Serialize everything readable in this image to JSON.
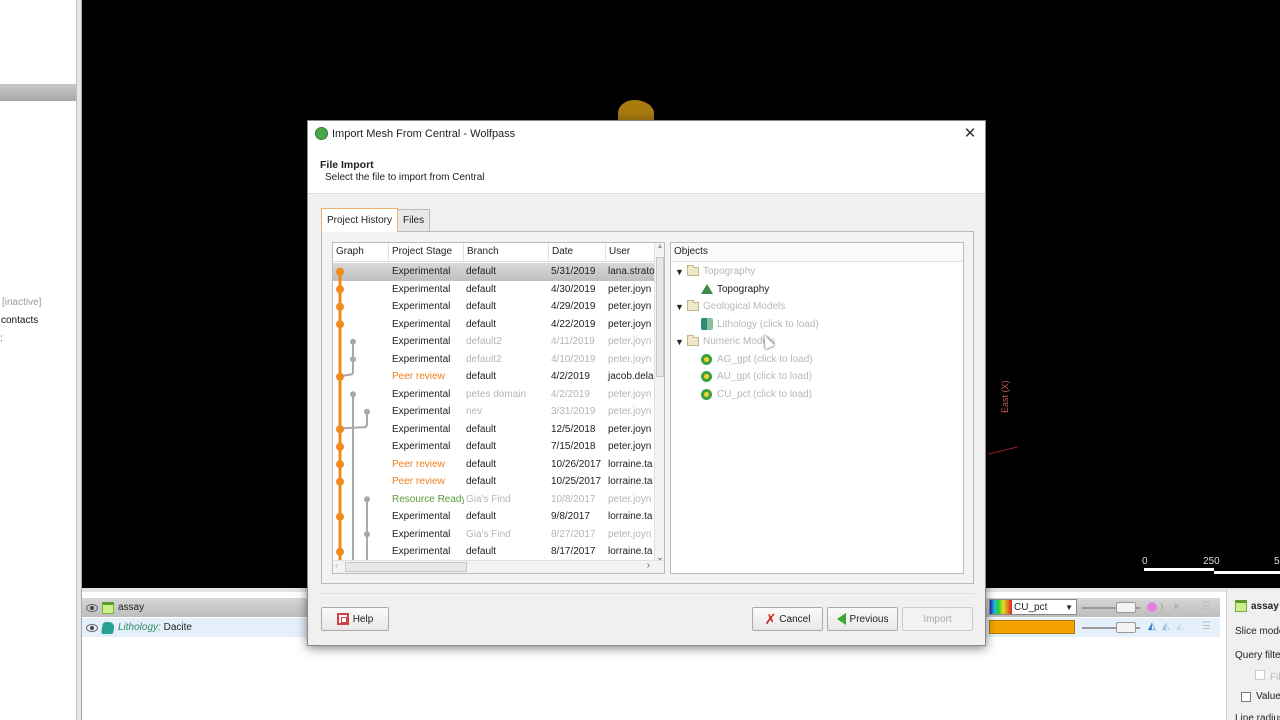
{
  "left_panel": {
    "inactive_label": "[inactive]",
    "contacts_label": "contacts",
    "tick": ":"
  },
  "viewport": {
    "axis_label": "East (X)",
    "scale_labels": [
      "0",
      "250",
      "5"
    ]
  },
  "scene_list": {
    "rows": [
      {
        "name": "assay",
        "prefix": "",
        "colormap": "CU_pct"
      },
      {
        "name": "Dacite",
        "prefix": "Lithology:",
        "swatch_color": "#f5a300"
      }
    ]
  },
  "properties": {
    "title": "assay",
    "slice_mode": "Slice mode",
    "query_filter": "Query filter",
    "filter": "Filter",
    "value_filter": "Value filter",
    "line_radius": "Line radius"
  },
  "dialog": {
    "title": "Import Mesh From Central - Wolfpass",
    "close": "✕",
    "header_title": "File Import",
    "header_subtitle": "Select the file to import from Central",
    "tabs": [
      {
        "label": "Project History",
        "active": true
      },
      {
        "label": "Files",
        "active": false
      }
    ],
    "history": {
      "columns": [
        "Graph",
        "Project Stage",
        "Branch",
        "Date",
        "User"
      ],
      "rows": [
        {
          "stage": "Experimental",
          "branch": "default",
          "date": "5/31/2019",
          "user": "lana.strato",
          "muted": false,
          "stage_style": "normal",
          "selected": true
        },
        {
          "stage": "Experimental",
          "branch": "default",
          "date": "4/30/2019",
          "user": "peter.joyn",
          "muted": false,
          "stage_style": "normal"
        },
        {
          "stage": "Experimental",
          "branch": "default",
          "date": "4/29/2019",
          "user": "peter.joyn",
          "muted": false,
          "stage_style": "normal"
        },
        {
          "stage": "Experimental",
          "branch": "default",
          "date": "4/22/2019",
          "user": "peter.joyn",
          "muted": false,
          "stage_style": "normal"
        },
        {
          "stage": "Experimental",
          "branch": "default2",
          "date": "4/11/2019",
          "user": "peter.joyn",
          "muted": true,
          "stage_style": "normal"
        },
        {
          "stage": "Experimental",
          "branch": "default2",
          "date": "4/10/2019",
          "user": "peter.joyn",
          "muted": true,
          "stage_style": "normal"
        },
        {
          "stage": "Peer review",
          "branch": "default",
          "date": "4/2/2019",
          "user": "jacob.dela",
          "muted": false,
          "stage_style": "orange"
        },
        {
          "stage": "Experimental",
          "branch": "petes domain",
          "date": "4/2/2019",
          "user": "peter.joyn",
          "muted": true,
          "stage_style": "normal"
        },
        {
          "stage": "Experimental",
          "branch": "nev",
          "date": "3/31/2019",
          "user": "peter.joyn",
          "muted": true,
          "stage_style": "normal"
        },
        {
          "stage": "Experimental",
          "branch": "default",
          "date": "12/5/2018",
          "user": "peter.joyn",
          "muted": false,
          "stage_style": "normal"
        },
        {
          "stage": "Experimental",
          "branch": "default",
          "date": "7/15/2018",
          "user": "peter.joyn",
          "muted": false,
          "stage_style": "normal"
        },
        {
          "stage": "Peer review",
          "branch": "default",
          "date": "10/26/2017",
          "user": "lorraine.ta",
          "muted": false,
          "stage_style": "orange"
        },
        {
          "stage": "Peer review",
          "branch": "default",
          "date": "10/25/2017",
          "user": "lorraine.ta",
          "muted": false,
          "stage_style": "orange"
        },
        {
          "stage": "Resource Ready",
          "branch": "Gia's Find",
          "date": "10/8/2017",
          "user": "peter.joyn",
          "muted": true,
          "stage_style": "green"
        },
        {
          "stage": "Experimental",
          "branch": "default",
          "date": "9/8/2017",
          "user": "lorraine.ta",
          "muted": false,
          "stage_style": "normal"
        },
        {
          "stage": "Experimental",
          "branch": "Gia's Find",
          "date": "8/27/2017",
          "user": "peter.joyn",
          "muted": true,
          "stage_style": "normal"
        },
        {
          "stage": "Experimental",
          "branch": "default",
          "date": "8/17/2017",
          "user": "lorraine.ta",
          "muted": false,
          "stage_style": "normal"
        }
      ]
    },
    "objects": {
      "header": "Objects",
      "tree": [
        {
          "label": "Topography",
          "type": "folder",
          "level": 0,
          "muted": true
        },
        {
          "label": "Topography",
          "type": "topo",
          "level": 1,
          "muted": false
        },
        {
          "label": "Geological Models",
          "type": "folder",
          "level": 0,
          "muted": true
        },
        {
          "label": "Lithology (click to load)",
          "type": "geo",
          "level": 1,
          "muted": true
        },
        {
          "label": "Numeric Models",
          "type": "folder",
          "level": 0,
          "muted": true
        },
        {
          "label": "AG_gpt (click to load)",
          "type": "num",
          "level": 1,
          "muted": true
        },
        {
          "label": "AU_gpt (click to load)",
          "type": "num",
          "level": 1,
          "muted": true
        },
        {
          "label": "CU_pct (click to load)",
          "type": "num",
          "level": 1,
          "muted": true
        }
      ]
    },
    "buttons": {
      "help": "Help",
      "cancel": "Cancel",
      "previous": "Previous",
      "import": "Import"
    }
  },
  "colors": {
    "graph_main": "#f08a1e",
    "graph_branch": "#a8a8a8"
  }
}
